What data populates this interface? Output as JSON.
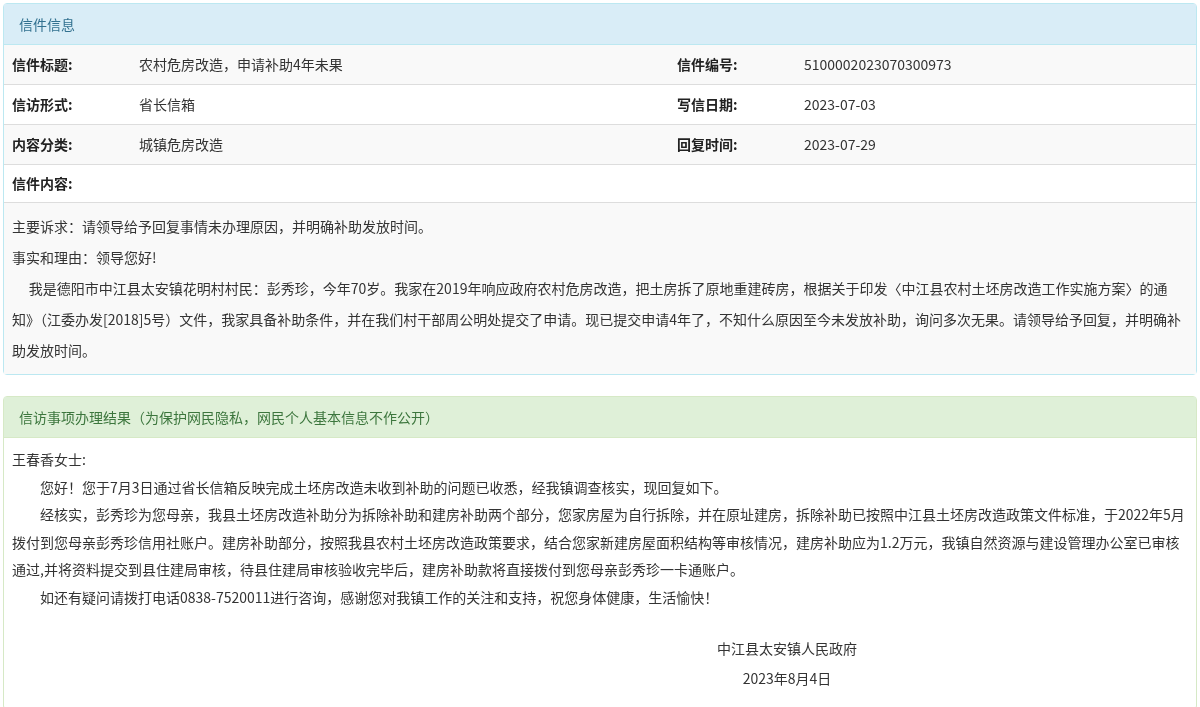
{
  "letter_panel": {
    "title": "信件信息",
    "fields": [
      {
        "label": "信件标题:",
        "value": "农村危房改造，申请补助4年未果",
        "label_2": "信件编号:",
        "value_2": "5100002023070300973"
      },
      {
        "label": "信访形式:",
        "value": "省长信箱",
        "label_2": "写信日期:",
        "value_2": "2023-07-03"
      },
      {
        "label": "内容分类:",
        "value": "城镇危房改造",
        "label_2": "回复时间:",
        "value_2": "2023-07-29"
      }
    ],
    "content_label": "信件内容:",
    "paragraphs": [
      {
        "text": "主要诉求：请领导给予回复事情未办理原因，并明确补助发放时间。",
        "indent": false
      },
      {
        "text": "事实和理由：领导您好!",
        "indent": false
      },
      {
        "text": "我是德阳市中江县太安镇花明村村民：彭秀珍，今年70岁。我家在2019年响应政府农村危房改造，把土房拆了原地重建砖房，根据关于印发〈中江县农村土坯房改造工作实施方案〉的通知》（江委办发[2018]5号）文件，我家具备补助条件，并在我们村干部周公明处提交了申请。现已提交申请4年了，不知什么原因至今未发放补助，询问多次无果。请领导给予回复，并明确补助发放时间。",
        "indent": true
      }
    ]
  },
  "result_panel": {
    "title": "信访事项办理结果（为保护网民隐私，网民个人基本信息不作公开）",
    "salutation": "王春香女士:",
    "paragraphs": [
      "您好！您于7月3日通过省长信箱反映完成土坯房改造未收到补助的问题已收悉，经我镇调查核实，现回复如下。",
      "经核实，彭秀珍为您母亲，我县土坯房改造补助分为拆除补助和建房补助两个部分，您家房屋为自行拆除，并在原址建房，拆除补助已按照中江县土坯房改造政策文件标准，于2022年5月拨付到您母亲彭秀珍信用社账户。建房补助部分，按照我县农村土坯房改造政策要求，结合您家新建房屋面积结构等审核情况，建房补助应为1.2万元，我镇自然资源与建设管理办公室已审核通过,并将资料提交到县住建局审核，待县住建局审核验收完毕后，建房补助款将直接拨付到您母亲彭秀珍一卡通账户。",
      "如还有疑问请拨打电话0838-7520011进行咨询，感谢您对我镇工作的关注和支持，祝您身体健康，生活愉快！"
    ],
    "signature": "中江县太安镇人民政府",
    "date": "2023年8月4日"
  }
}
